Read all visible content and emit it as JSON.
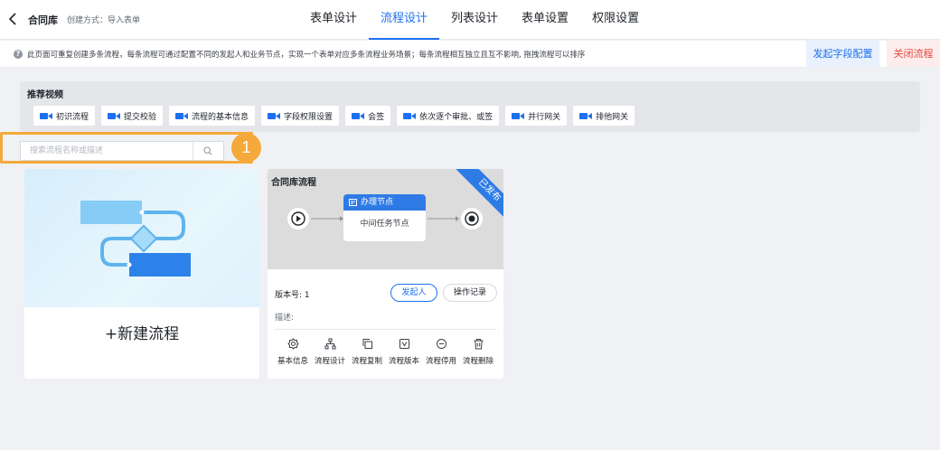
{
  "header": {
    "title": "合同库",
    "create_mode": "创建方式：导入表单",
    "tabs": [
      {
        "label": "表单设计",
        "active": false
      },
      {
        "label": "流程设计",
        "active": true
      },
      {
        "label": "列表设计",
        "active": false
      },
      {
        "label": "表单设置",
        "active": false
      },
      {
        "label": "权限设置",
        "active": false
      }
    ]
  },
  "notice": {
    "text": "此页面可重复创建多条流程，每条流程可通过配置不同的发起人和业务节点，实现一个表单对应多条流程业务场景；每条流程相互独立且互不影响, 拖拽流程可以排序",
    "config_button": "发起字段配置",
    "close_button": "关闭流程"
  },
  "videos": {
    "title": "推荐视频",
    "items": [
      "初识流程",
      "提交校验",
      "流程的基本信息",
      "字段权限设置",
      "会签",
      "依次逐个审批、或签",
      "并行网关",
      "排他网关"
    ]
  },
  "search": {
    "placeholder": "搜索流程名称或描述",
    "value": ""
  },
  "step_badge": "1",
  "new_flow": {
    "label": "+新建流程"
  },
  "flow_card": {
    "name": "合同库流程",
    "status": "已发布",
    "node_title": "办理节点",
    "node_body": "中间任务节点",
    "version_label": "版本号:",
    "version_value": "1",
    "initiator_button": "发起人",
    "log_button": "操作记录",
    "description_label": "描述:",
    "actions": [
      "基本信息",
      "流程设计",
      "流程复制",
      "流程版本",
      "流程停用",
      "流程删除"
    ]
  },
  "colors": {
    "accent": "#1d6ff2",
    "danger": "#e8473f",
    "highlight": "#f4a93a"
  }
}
